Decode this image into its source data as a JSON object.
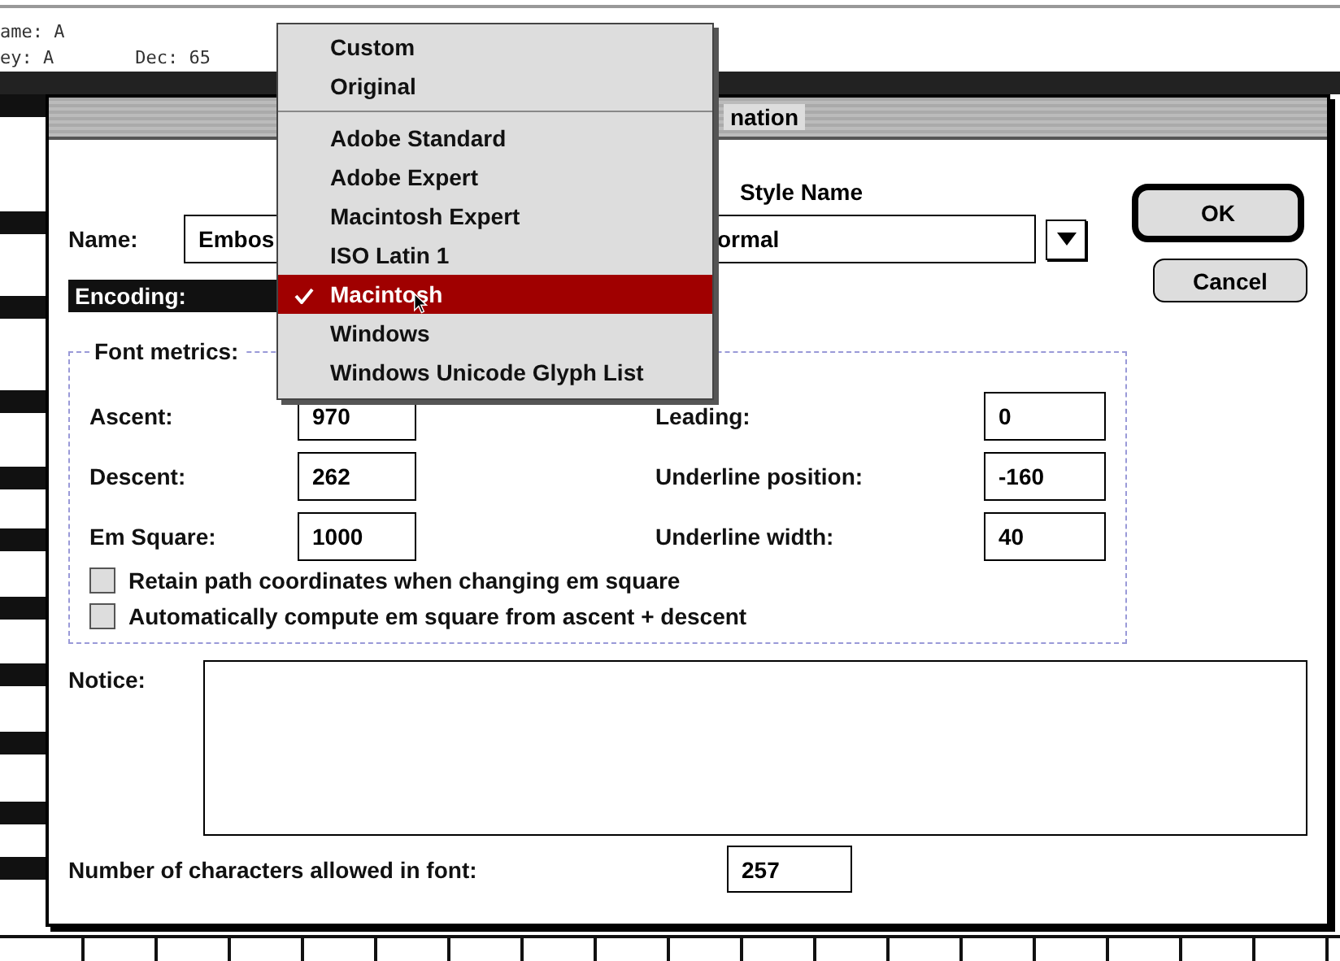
{
  "background_window": {
    "lines": [
      {
        "text": "ame: A"
      },
      {
        "text": "ey: A",
        "extra": "Dec: 65"
      }
    ]
  },
  "dialog": {
    "title": "nation",
    "style_name_label": "Style Name",
    "name": {
      "label": "Name:",
      "value": "Embos"
    },
    "style": {
      "value": "ormal"
    },
    "encoding": {
      "label": "Encoding:",
      "open": true
    },
    "buttons": [
      {
        "label": "OK",
        "default": true
      },
      {
        "label": "Cancel",
        "default": false
      }
    ],
    "font_metrics": {
      "legend": "Font metrics:",
      "left": [
        {
          "label": "Ascent:",
          "value": "970"
        },
        {
          "label": "Descent:",
          "value": "262"
        },
        {
          "label": "Em Square:",
          "value": "1000"
        }
      ],
      "right": [
        {
          "label": "Leading:",
          "value": "0"
        },
        {
          "label": "Underline position:",
          "value": "-160"
        },
        {
          "label": "Underline width:",
          "value": "40"
        }
      ],
      "options": [
        {
          "label": "Retain path coordinates when changing em square",
          "checked": false
        },
        {
          "label": "Automatically compute em square from ascent + descent",
          "checked": false
        }
      ]
    },
    "notice": {
      "label": "Notice:"
    },
    "char_count": {
      "label": "Number of characters allowed in font:",
      "value": "257"
    }
  },
  "encoding_menu": {
    "items": [
      {
        "kind": "item",
        "label": "Custom",
        "selected": false
      },
      {
        "kind": "item",
        "label": "Original",
        "selected": false
      },
      {
        "kind": "separator"
      },
      {
        "kind": "item",
        "label": "Adobe Standard",
        "selected": false
      },
      {
        "kind": "item",
        "label": "Adobe Expert",
        "selected": false
      },
      {
        "kind": "item",
        "label": "Macintosh Expert",
        "selected": false
      },
      {
        "kind": "item",
        "label": "ISO Latin 1",
        "selected": false
      },
      {
        "kind": "item",
        "label": "Macintosh",
        "selected": true
      },
      {
        "kind": "item",
        "label": "Windows",
        "selected": false
      },
      {
        "kind": "item",
        "label": "Windows Unicode Glyph List",
        "selected": false
      }
    ]
  }
}
